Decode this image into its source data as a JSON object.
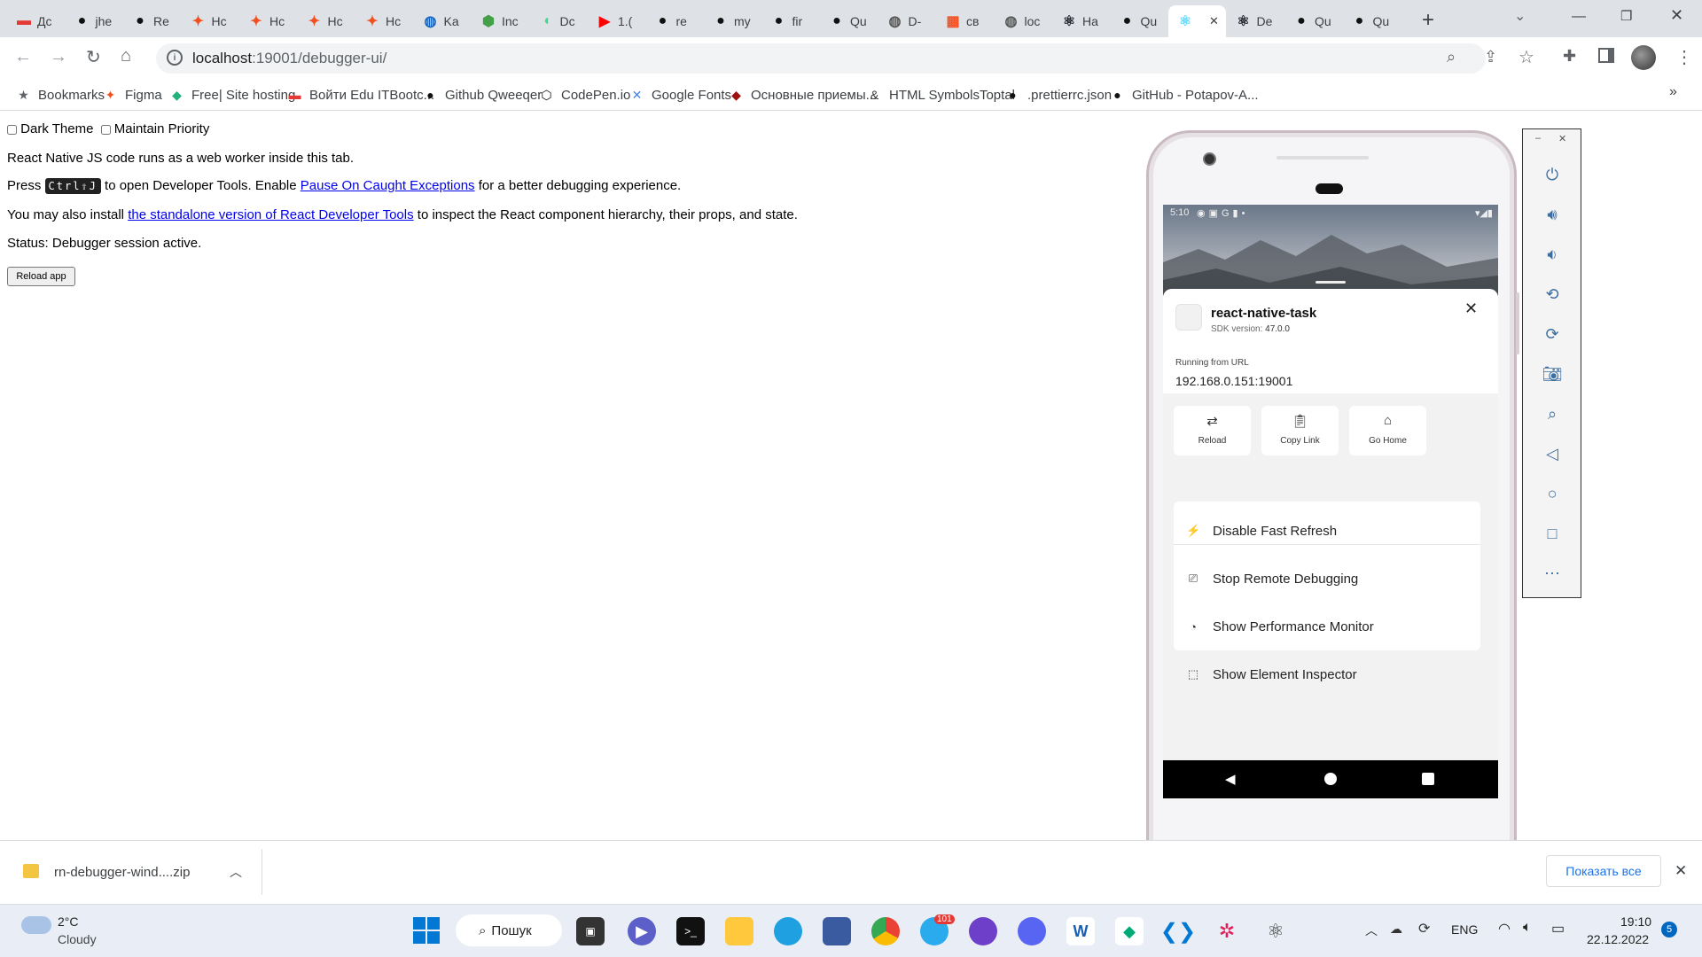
{
  "tabs": [
    {
      "label": "Дс",
      "icon": "brand-icon",
      "color": "#e53935"
    },
    {
      "label": "jhe",
      "icon": "github-icon",
      "color": "#111"
    },
    {
      "label": "Re",
      "icon": "github-icon",
      "color": "#111"
    },
    {
      "label": "Hc",
      "icon": "figma-icon",
      "color": "#f24e1e"
    },
    {
      "label": "Hc",
      "icon": "figma-icon",
      "color": "#f24e1e"
    },
    {
      "label": "Hc",
      "icon": "figma-icon",
      "color": "#f24e1e"
    },
    {
      "label": "Hc",
      "icon": "figma-icon",
      "color": "#f24e1e"
    },
    {
      "label": "Ka",
      "icon": "globe-icon",
      "color": "#1565c0"
    },
    {
      "label": "Inc",
      "icon": "node-icon",
      "color": "#43a047"
    },
    {
      "label": "Dc",
      "icon": "android-icon",
      "color": "#3ddc84"
    },
    {
      "label": "1.(",
      "icon": "youtube-icon",
      "color": "#ff0000"
    },
    {
      "label": "re",
      "icon": "github-icon",
      "color": "#111"
    },
    {
      "label": "my",
      "icon": "github-icon",
      "color": "#111"
    },
    {
      "label": "fir",
      "icon": "github-icon",
      "color": "#111"
    },
    {
      "label": "Qu",
      "icon": "github-icon",
      "color": "#111"
    },
    {
      "label": "D-",
      "icon": "globe-icon",
      "color": "#555"
    },
    {
      "label": "св",
      "icon": "microsoft-icon",
      "color": "#f25022"
    },
    {
      "label": "loc",
      "icon": "globe-icon",
      "color": "#555"
    },
    {
      "label": "Ha",
      "icon": "react-icon",
      "color": "#20232a"
    },
    {
      "label": "Qu",
      "icon": "github-icon",
      "color": "#111"
    },
    {
      "label": "",
      "icon": "react-icon",
      "color": "#61dafb",
      "active": true
    },
    {
      "label": "De",
      "icon": "react-icon",
      "color": "#20232a"
    },
    {
      "label": "Qu",
      "icon": "github-icon",
      "color": "#111"
    },
    {
      "label": "Qu",
      "icon": "github-icon",
      "color": "#111"
    }
  ],
  "address": {
    "host": "localhost",
    "path": ":19001/debugger-ui/"
  },
  "bookmarks": [
    {
      "label": "Bookmarks",
      "icon": "star-icon"
    },
    {
      "label": "Figma",
      "icon": "figma-icon"
    },
    {
      "label": "Free| Site hosting",
      "icon": "diamond-icon"
    },
    {
      "label": "Войти Edu ITBootc...",
      "icon": "brand-icon"
    },
    {
      "label": "Github Qweeqer",
      "icon": "github-icon"
    },
    {
      "label": "CodePen.io",
      "icon": "codepen-icon"
    },
    {
      "label": "Google Fonts",
      "icon": "google-fonts-icon"
    },
    {
      "label": "Основные приемы...",
      "icon": "ruby-icon"
    },
    {
      "label": "HTML SymbolsToptal",
      "icon": "ampersand-icon"
    },
    {
      "label": ".prettierrc.json",
      "icon": "github-icon"
    },
    {
      "label": "GitHub - Potapov-A...",
      "icon": "github-icon"
    }
  ],
  "page": {
    "dark_theme_label": "Dark Theme",
    "maintain_priority_label": "Maintain Priority",
    "line1": "React Native JS code runs as a web worker inside this tab.",
    "line2_prefix": "Press ",
    "line2_kbd": "Ctrl⇧J",
    "line2_mid": " to open Developer Tools. Enable ",
    "line2_link": "Pause On Caught Exceptions",
    "line2_suffix": " for a better debugging experience.",
    "line3_prefix": "You may also install ",
    "line3_link": "the standalone version of React Developer Tools",
    "line3_suffix": " to inspect the React component hierarchy, their props, and state.",
    "status": "Status: Debugger session active.",
    "reload_button": "Reload app"
  },
  "phone": {
    "status_time": "5:10",
    "app_name": "react-native-task",
    "sdk_label": "SDK version:",
    "sdk_version": "47.0.0",
    "running_label": "Running from URL",
    "url": "192.168.0.151:19001",
    "actions": [
      {
        "label": "Reload",
        "icon": "reload-icon"
      },
      {
        "label": "Copy Link",
        "icon": "clipboard-icon"
      },
      {
        "label": "Go Home",
        "icon": "home-icon"
      }
    ],
    "menu": [
      {
        "label": "Disable Fast Refresh",
        "icon": "runner-icon"
      },
      {
        "label": "Stop Remote Debugging",
        "icon": "debug-icon"
      },
      {
        "label": "Show Performance Monitor",
        "icon": "gauge-icon"
      },
      {
        "label": "Show Element Inspector",
        "icon": "inspector-icon"
      }
    ]
  },
  "download": {
    "filename": "rn-debugger-wind....zip",
    "show_all": "Показать все"
  },
  "taskbar": {
    "weather_temp": "2°C",
    "weather_desc": "Cloudy",
    "search_label": "Пошук",
    "telegram_badge": "101",
    "lang": "ENG",
    "time": "19:10",
    "date": "22.12.2022",
    "notif_count": "5"
  }
}
